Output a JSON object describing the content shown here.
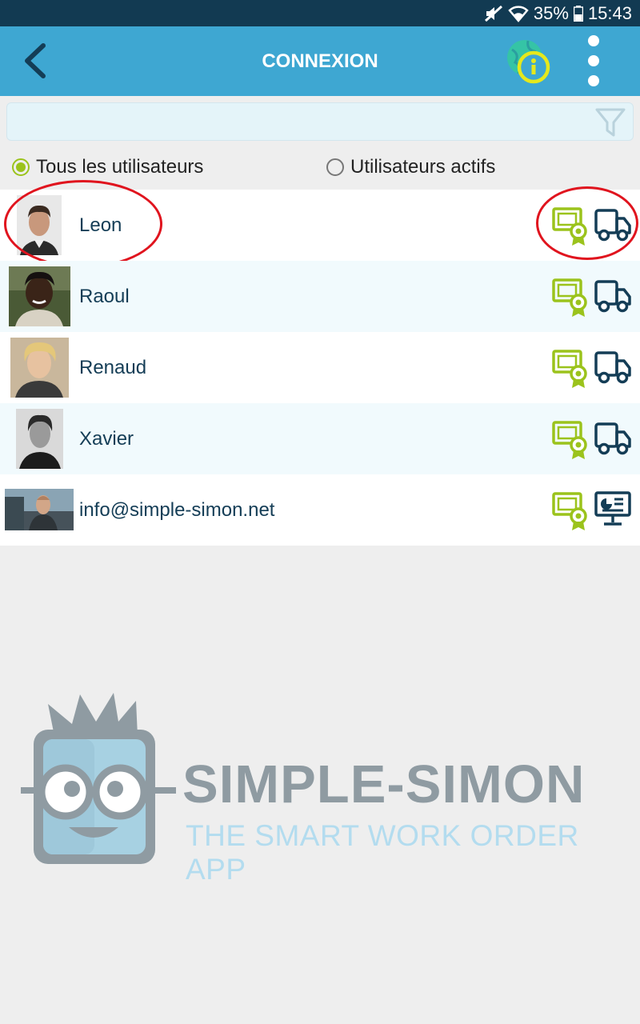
{
  "status_bar": {
    "battery": "35%",
    "time": "15:43"
  },
  "app_bar": {
    "title": "CONNEXION"
  },
  "search": {
    "placeholder": "",
    "value": ""
  },
  "filter": {
    "options": [
      {
        "label": "Tous les utilisateurs",
        "selected": true
      },
      {
        "label": "Utilisateurs actifs",
        "selected": false
      }
    ]
  },
  "users": [
    {
      "name": "Leon",
      "role_icon": "truck-icon"
    },
    {
      "name": "Raoul",
      "role_icon": "truck-icon"
    },
    {
      "name": "Renaud",
      "role_icon": "truck-icon"
    },
    {
      "name": "Xavier",
      "role_icon": "truck-icon"
    },
    {
      "name": "info@simple-simon.net",
      "role_icon": "monitor-chart-icon"
    }
  ],
  "brand": {
    "name": "SIMPLE-SIMON",
    "tagline": "THE SMART WORK ORDER APP"
  },
  "colors": {
    "app_bar": "#3ea7d2",
    "status_bar": "#123a52",
    "accent_green": "#9bc31c",
    "icon_dark": "#143d56",
    "highlight_red": "#e0141e"
  }
}
